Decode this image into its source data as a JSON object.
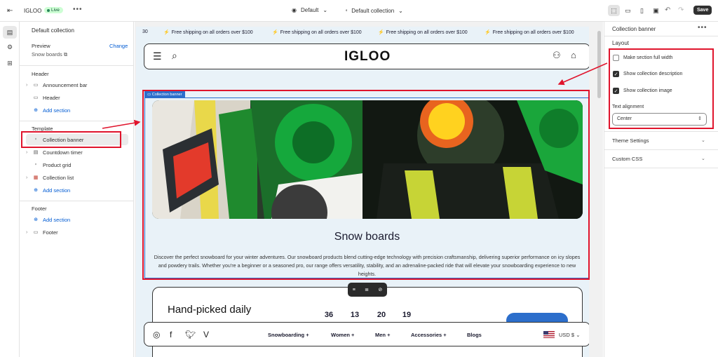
{
  "topbar": {
    "store_name": "IGLOO",
    "live_badge": "Live",
    "more": "•••",
    "theme": "Default",
    "template": "Default collection",
    "save_label": "Save"
  },
  "left_panel": {
    "title": "Default collection",
    "preview_label": "Preview",
    "change_label": "Change",
    "preview_value": "Snow boards",
    "header_group": "Header",
    "header_items": [
      "Announcement bar",
      "Header"
    ],
    "add_section": "Add section",
    "template_group": "Template",
    "template_items": [
      "Collection banner",
      "Countdown timer",
      "Product grid",
      "Collection list"
    ],
    "footer_group": "Footer",
    "footer_items": [
      "Footer"
    ]
  },
  "preview": {
    "announcement_count": "30",
    "announcement_text": "Free shipping on all orders over $100",
    "logo": "IGLOO",
    "banner_tag": "Collection banner",
    "banner_title": "Snow boards",
    "banner_description": "Discover the perfect snowboard for your winter adventures. Our snowboard products blend cutting-edge technology with precision craftsmanship, delivering superior performance on icy slopes and powdery trails. Whether you're a beginner or a seasoned pro, our range offers versatility, stability, and an adrenaline-packed ride that will elevate your snowboarding experience to new heights.",
    "below_heading": "Hand-picked daily",
    "countdown": [
      "36",
      "13",
      "20",
      "19"
    ],
    "footer_links": [
      "Snowboarding",
      "Women",
      "Men",
      "Accessories",
      "Blogs"
    ],
    "currency": "USD $"
  },
  "right_panel": {
    "title": "Collection banner",
    "more": "•••",
    "layout_heading": "Layout",
    "options": [
      {
        "label": "Make section full width",
        "checked": false
      },
      {
        "label": "Show collection description",
        "checked": true
      },
      {
        "label": "Show collection image",
        "checked": true
      }
    ],
    "alignment_label": "Text alignment",
    "alignment_value": "Center",
    "sections": [
      "Theme Settings",
      "Custom CSS"
    ]
  },
  "colors": {
    "accent": "#2c6ecb",
    "highlight": "#e0142c",
    "preview_bg": "#e9f2f8"
  }
}
